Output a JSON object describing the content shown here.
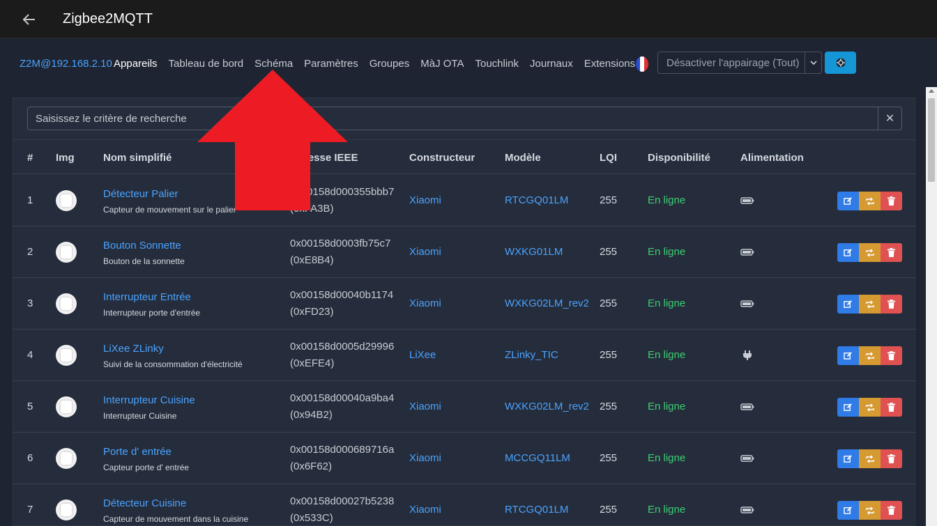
{
  "app": {
    "title": "Zigbee2MQTT"
  },
  "nav": {
    "brand": "Z2M@192.168.2.10",
    "items": [
      {
        "label": "Appareils",
        "active": true
      },
      {
        "label": "Tableau de bord"
      },
      {
        "label": "Schéma"
      },
      {
        "label": "Paramètres"
      },
      {
        "label": "Groupes"
      },
      {
        "label": "MàJ OTA"
      },
      {
        "label": "Touchlink"
      },
      {
        "label": "Journaux"
      },
      {
        "label": "Extensions"
      }
    ],
    "permit_join_select": "Désactiver l'appairage (Tout)",
    "language_icon": "french-flag-icon",
    "settings_icon": "gear-icon"
  },
  "search": {
    "placeholder": "Saisissez le critère de recherche",
    "clear_icon": "close-icon"
  },
  "table": {
    "headers": [
      "#",
      "Img",
      "Nom simplifié",
      "Adresse IEEE",
      "Constructeur",
      "Modèle",
      "LQI",
      "Disponibilité",
      "Alimentation"
    ],
    "rows": [
      {
        "num": "1",
        "name": "Détecteur Palier",
        "description": "Capteur de mouvement sur le palier",
        "ieee": "0x00158d000355bbb7",
        "nwk": "(0xFA3B)",
        "vendor": "Xiaomi",
        "model": "RTCGQ01LM",
        "lqi": "255",
        "availability": "En ligne",
        "power": "battery-icon"
      },
      {
        "num": "2",
        "name": "Bouton Sonnette",
        "description": "Bouton de la sonnette",
        "ieee": "0x00158d0003fb75c7",
        "nwk": "(0xE8B4)",
        "vendor": "Xiaomi",
        "model": "WXKG01LM",
        "lqi": "255",
        "availability": "En ligne",
        "power": "battery-icon"
      },
      {
        "num": "3",
        "name": "Interrupteur Entrée",
        "description": "Interrupteur porte d'entrée",
        "ieee": "0x00158d00040b1174",
        "nwk": "(0xFD23)",
        "vendor": "Xiaomi",
        "model": "WXKG02LM_rev2",
        "lqi": "255",
        "availability": "En ligne",
        "power": "battery-icon"
      },
      {
        "num": "4",
        "name": "LiXee ZLinky",
        "description": "Suivi de la consommation d'électricité",
        "ieee": "0x00158d0005d29996",
        "nwk": "(0xEFE4)",
        "vendor": "LiXee",
        "model": "ZLinky_TIC",
        "lqi": "255",
        "availability": "En ligne",
        "power": "plug-icon"
      },
      {
        "num": "5",
        "name": "Interrupteur Cuisine",
        "description": "Interrupteur Cuisine",
        "ieee": "0x00158d00040a9ba4",
        "nwk": "(0x94B2)",
        "vendor": "Xiaomi",
        "model": "WXKG02LM_rev2",
        "lqi": "255",
        "availability": "En ligne",
        "power": "battery-icon"
      },
      {
        "num": "6",
        "name": "Porte d' entrée",
        "description": "Capteur porte d' entrée",
        "ieee": "0x00158d000689716a",
        "nwk": "(0x6F62)",
        "vendor": "Xiaomi",
        "model": "MCCGQ11LM",
        "lqi": "255",
        "availability": "En ligne",
        "power": "battery-icon"
      },
      {
        "num": "7",
        "name": "Détecteur Cuisine",
        "description": "Capteur de mouvement dans la cuisine",
        "ieee": "0x00158d00027b5238",
        "nwk": "(0x533C)",
        "vendor": "Xiaomi",
        "model": "RTCGQ01LM",
        "lqi": "255",
        "availability": "En ligne",
        "power": "battery-icon"
      }
    ]
  },
  "colors": {
    "accent": "#4aa3ff",
    "online": "#3ecf74",
    "edit": "#2f7be8",
    "rename": "#d69a33",
    "delete": "#e05252",
    "annotation_arrow": "#ed1c24"
  }
}
